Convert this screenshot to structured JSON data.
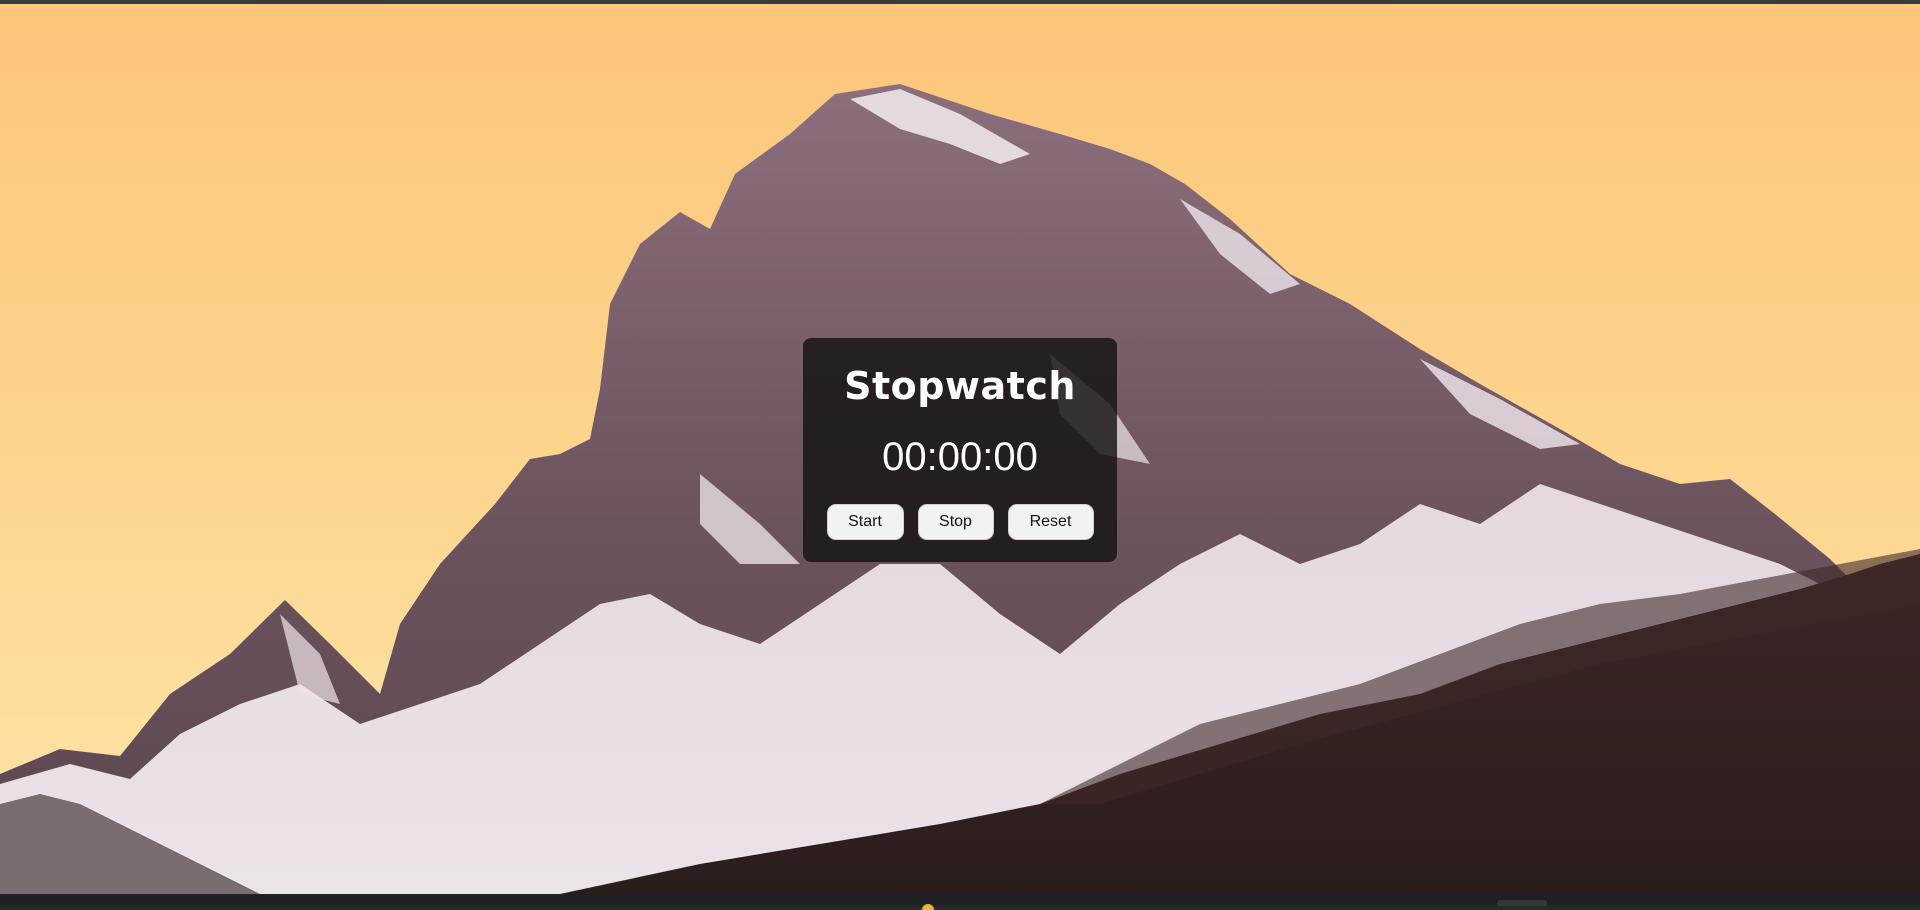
{
  "app": {
    "title": "Stopwatch",
    "time": "00:00:00"
  },
  "controls": {
    "start_label": "Start",
    "stop_label": "Stop",
    "reset_label": "Reset"
  },
  "colors": {
    "sky_top": "#fcc57a",
    "sky_bottom": "#fee6a8",
    "panel_bg": "rgba(20,18,20,0.82)",
    "button_bg": "#f2f2f2",
    "text": "#ffffff"
  }
}
